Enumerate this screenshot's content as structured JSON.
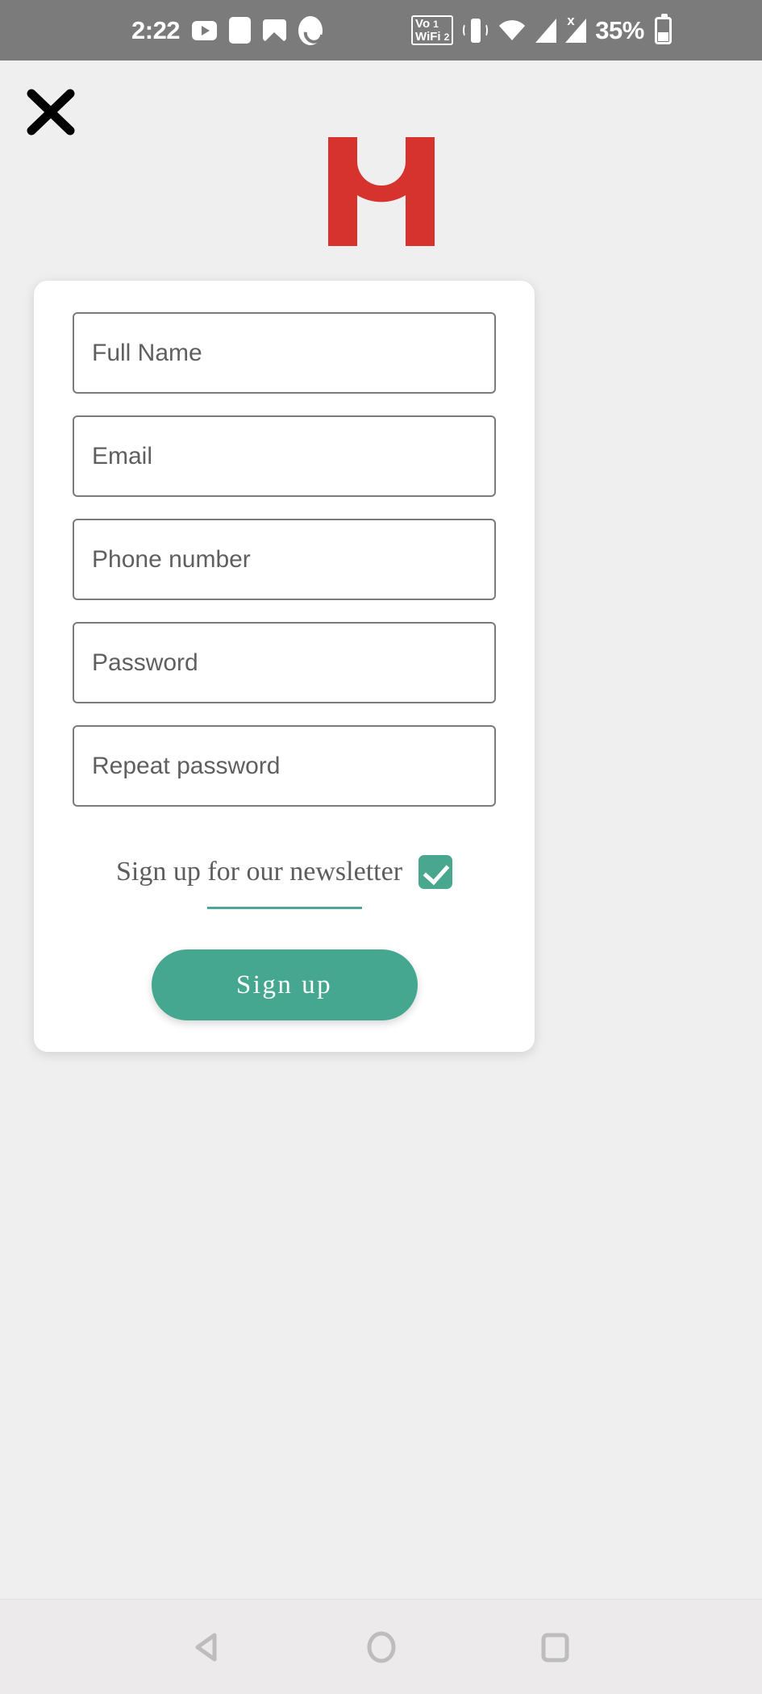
{
  "status_bar": {
    "time": "2:22",
    "battery_percent": "35%",
    "background_color": "#7b7b7b",
    "left_icons": [
      {
        "name": "youtube-icon",
        "label": "YouTube"
      },
      {
        "name": "app-notification-icon",
        "label": "App"
      },
      {
        "name": "gallery-icon",
        "label": "Gallery"
      },
      {
        "name": "phone-call-icon",
        "label": "Phone"
      }
    ],
    "vowifi": {
      "line1_label": "Vo",
      "line1_sim": "1",
      "line2_label": "WiFi",
      "line2_sim": "2"
    },
    "right_icons": [
      {
        "name": "vibrate-icon",
        "label": "Vibrate"
      },
      {
        "name": "wifi-icon",
        "label": "Wi-Fi"
      },
      {
        "name": "signal-sim1-icon",
        "label": "Signal SIM 1"
      },
      {
        "name": "signal-sim2-no-data-icon",
        "label": "Signal SIM 2 no data",
        "badge": "x"
      },
      {
        "name": "battery-icon",
        "label": "Battery"
      }
    ]
  },
  "page": {
    "background_color": "#efefef",
    "close_label": "Close"
  },
  "logo": {
    "name": "brand-m-logo",
    "alt": "M",
    "color": "#d6332e"
  },
  "form": {
    "fields": [
      {
        "name": "full-name-input",
        "placeholder": "Full Name",
        "value": "",
        "type": "text"
      },
      {
        "name": "email-input",
        "placeholder": "Email",
        "value": "",
        "type": "text"
      },
      {
        "name": "phone-number-input",
        "placeholder": "Phone number",
        "value": "",
        "type": "text"
      },
      {
        "name": "password-input",
        "placeholder": "Password",
        "value": "",
        "type": "text"
      },
      {
        "name": "repeat-password-input",
        "placeholder": "Repeat password",
        "value": "",
        "type": "text"
      }
    ],
    "newsletter": {
      "label": "Sign up for our newsletter",
      "checked": true,
      "accent_color": "#49a68f"
    },
    "submit": {
      "label": "Sign up",
      "background_color": "#45a78f",
      "text_color": "#ffffff"
    }
  },
  "nav_bar": {
    "background_color": "#eceaea",
    "buttons": [
      {
        "name": "nav-back-button",
        "label": "Back"
      },
      {
        "name": "nav-home-button",
        "label": "Home"
      },
      {
        "name": "nav-recents-button",
        "label": "Recents"
      }
    ]
  }
}
